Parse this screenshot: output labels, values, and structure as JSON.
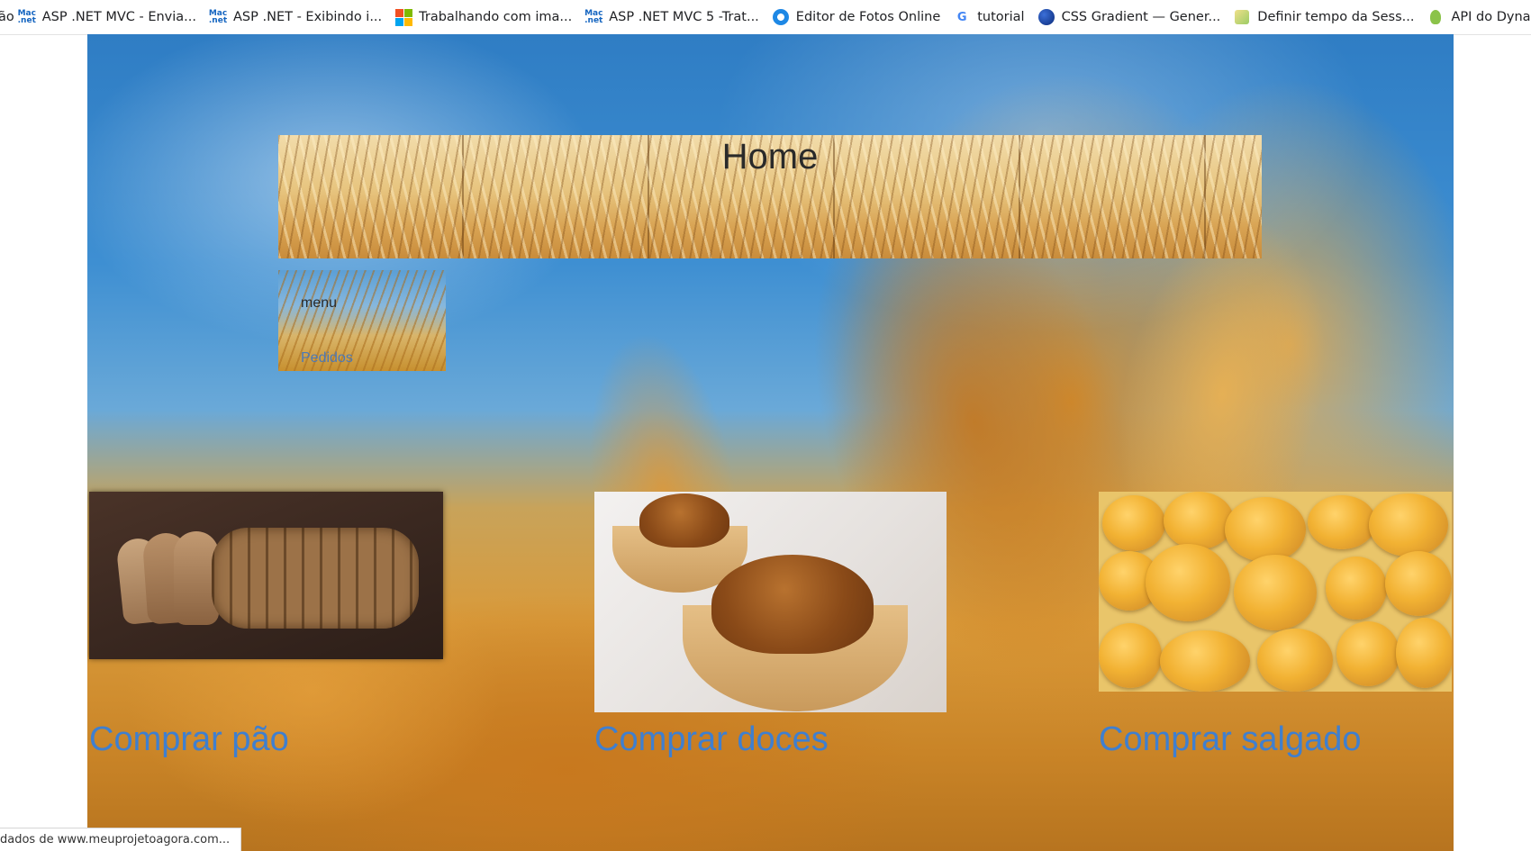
{
  "bookmarks": {
    "leading_fragment": "ão",
    "items": [
      {
        "label": "ASP .NET MVC -  Envia...",
        "icon": "dotnet-icon"
      },
      {
        "label": "ASP .NET - Exibindo i...",
        "icon": "dotnet-icon"
      },
      {
        "label": "Trabalhando com ima...",
        "icon": "microsoft-icon"
      },
      {
        "label": "ASP .NET MVC 5 -Trat...",
        "icon": "dotnet-icon"
      },
      {
        "label": "Editor de Fotos Online",
        "icon": "photo-editor-icon"
      },
      {
        "label": "tutorial",
        "icon": "google-translate-icon"
      },
      {
        "label": "CSS Gradient — Gener...",
        "icon": "css-gradient-icon"
      },
      {
        "label": "Definir tempo da Sess...",
        "icon": "session-icon"
      },
      {
        "label": "API do Dynadot",
        "icon": "dynadot-icon"
      }
    ]
  },
  "page": {
    "title": "Home",
    "menu": {
      "title": "menu",
      "link": "Pedidos"
    },
    "products": [
      {
        "link": "Comprar pão"
      },
      {
        "link": "Comprar doces"
      },
      {
        "link": "Comprar salgado"
      }
    ]
  },
  "status": "dados de www.meuprojetoagora.com..."
}
